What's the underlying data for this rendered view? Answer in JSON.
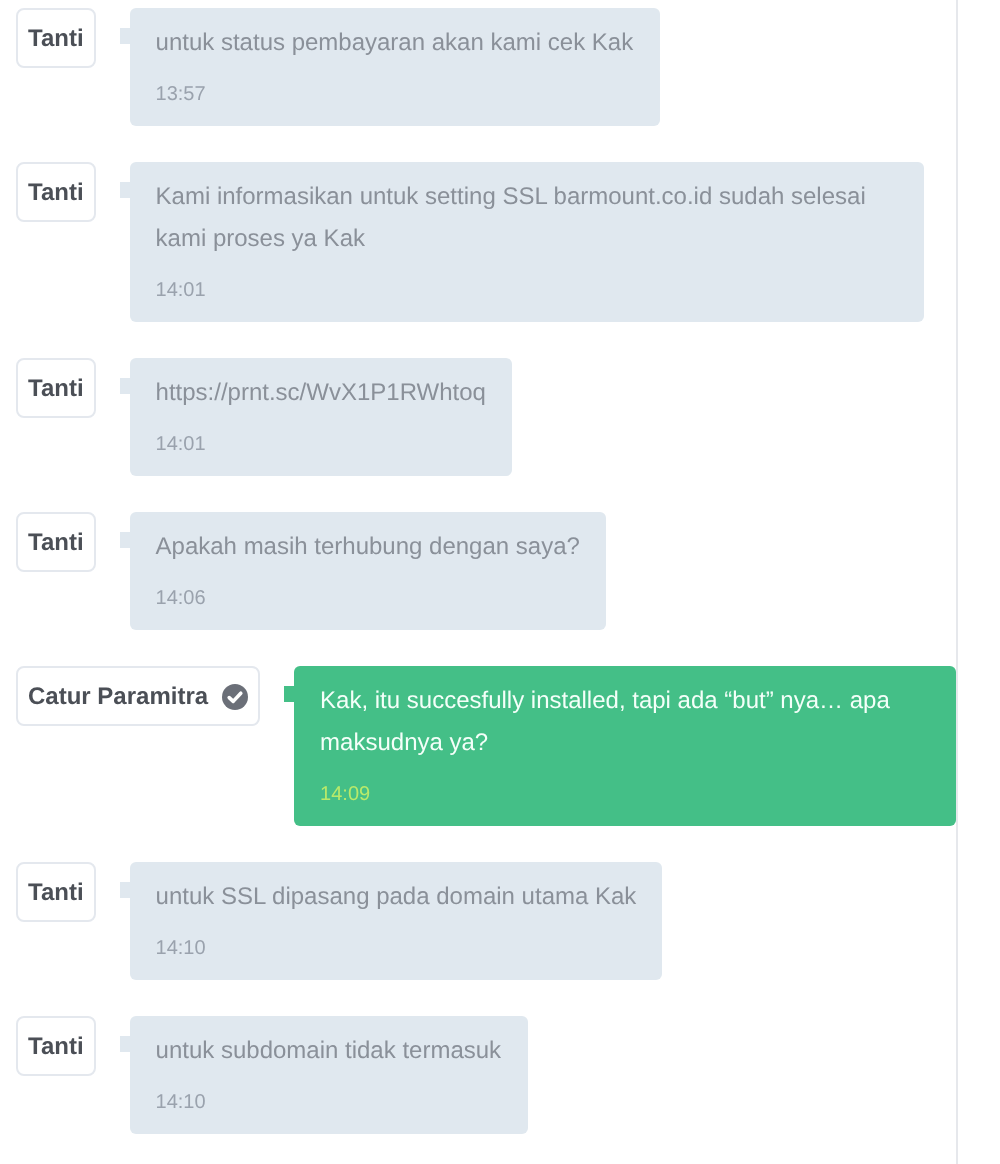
{
  "messages": [
    {
      "sender": "Tanti",
      "verified": false,
      "kind": "agent",
      "text": "untuk status pembayaran akan kami cek Kak",
      "time": "13:57"
    },
    {
      "sender": "Tanti",
      "verified": false,
      "kind": "agent",
      "text": "Kami informasikan untuk setting SSL barmount.co.id sudah selesai kami proses ya Kak",
      "time": "14:01"
    },
    {
      "sender": "Tanti",
      "verified": false,
      "kind": "agent",
      "text": "https://prnt.sc/WvX1P1RWhtoq",
      "time": "14:01"
    },
    {
      "sender": "Tanti",
      "verified": false,
      "kind": "agent",
      "text": "Apakah masih terhubung dengan saya?",
      "time": "14:06"
    },
    {
      "sender": "Catur Paramitra",
      "verified": true,
      "kind": "self",
      "text": "Kak, itu succesfully installed, tapi ada “but” nya… apa maksudnya ya?",
      "time": "14:09"
    },
    {
      "sender": "Tanti",
      "verified": false,
      "kind": "agent",
      "text": "untuk SSL dipasang pada domain utama Kak",
      "time": "14:10"
    },
    {
      "sender": "Tanti",
      "verified": false,
      "kind": "agent",
      "text": "untuk subdomain tidak termasuk",
      "time": "14:10"
    }
  ]
}
